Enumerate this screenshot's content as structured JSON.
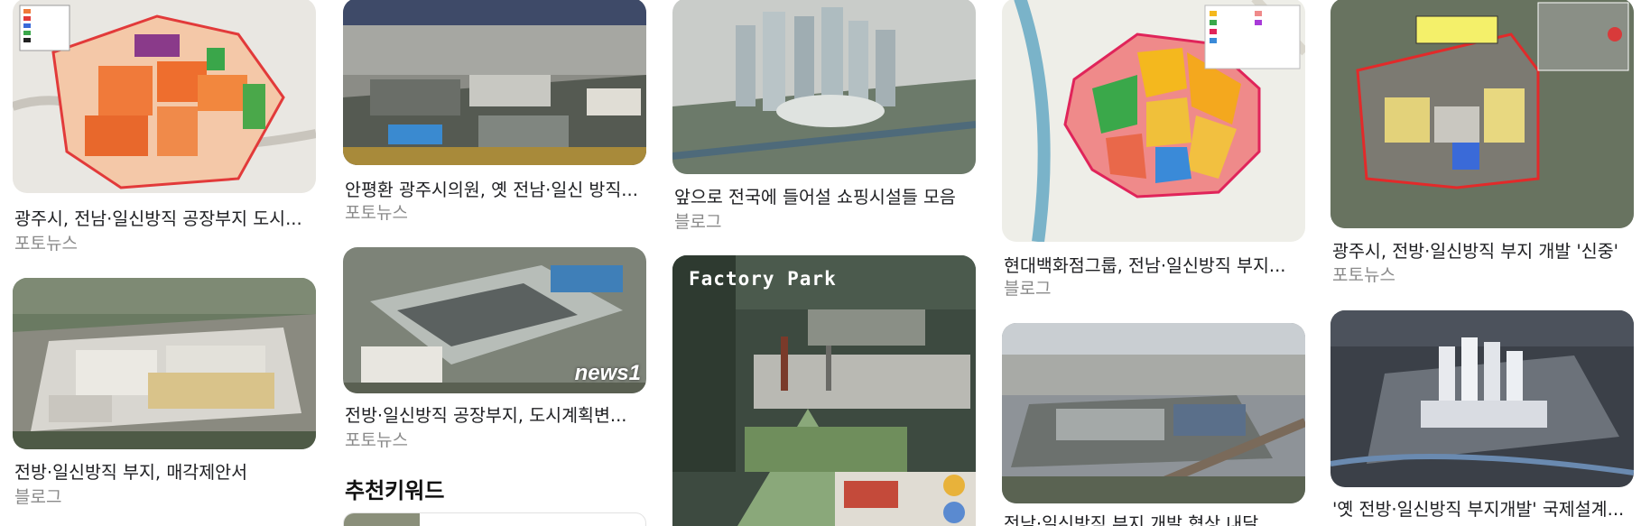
{
  "results": {
    "col1": [
      {
        "title": "광주시, 전남·일신방직 공장부지 도시...",
        "source": "포토뉴스"
      },
      {
        "title": "전방·일신방직 부지, 매각제안서",
        "source": "블로그"
      }
    ],
    "col2": [
      {
        "title": "안평환 광주시의원, 옛 전남·일신 방직...",
        "source": "포토뉴스"
      },
      {
        "title": "전방·일신방직 공장부지, 도시계획변...",
        "source": "포토뉴스"
      }
    ],
    "col3": [
      {
        "title": "앞으로 전국에 들어설 쇼핑시설들 모음",
        "source": "블로그"
      },
      {
        "title": "",
        "source": "",
        "overlay_text": "Factory Park"
      }
    ],
    "col4": [
      {
        "title": "현대백화점그룹, 전남·일신방직 부지...",
        "source": "블로그"
      },
      {
        "title": "전남·일신방직 부지 개발 협상 내달...",
        "source": ""
      }
    ],
    "col5": [
      {
        "title": "광주시, 전방·일신방직 부지 개발 '신중'",
        "source": "포토뉴스"
      },
      {
        "title": "'옛 전방·일신방직 부지개발' 국제설계...",
        "source": ""
      }
    ]
  },
  "recommended": {
    "heading": "추천키워드"
  },
  "watermarks": {
    "news1": "news1"
  },
  "colors": {
    "title": "#202124",
    "source": "#8a8a8a",
    "section": "#111111"
  }
}
